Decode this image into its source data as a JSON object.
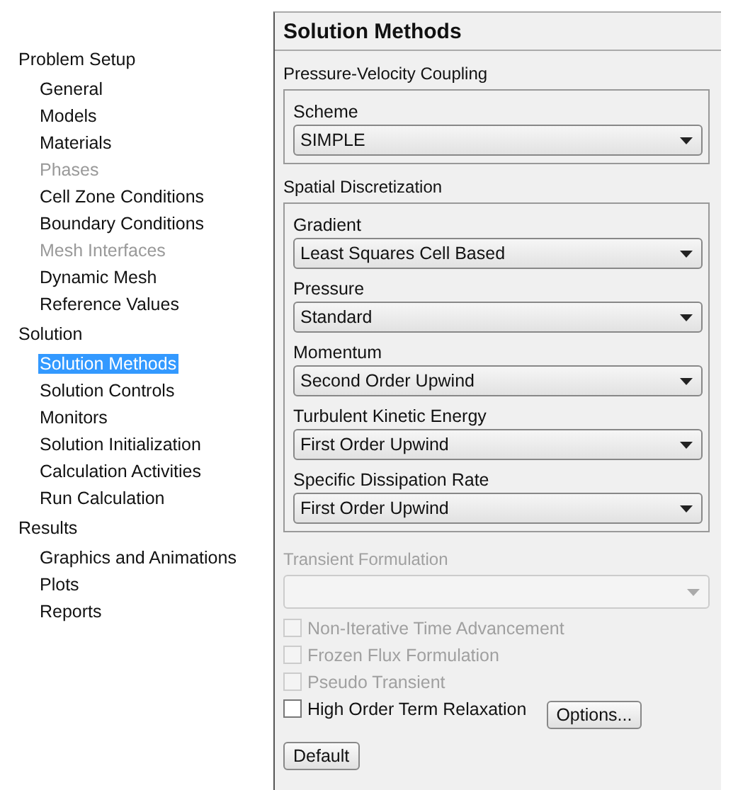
{
  "tree": [
    {
      "label": "Problem Setup",
      "items": [
        {
          "label": "General",
          "selected": false,
          "disabled": false
        },
        {
          "label": "Models",
          "selected": false,
          "disabled": false
        },
        {
          "label": "Materials",
          "selected": false,
          "disabled": false
        },
        {
          "label": "Phases",
          "selected": false,
          "disabled": true
        },
        {
          "label": "Cell Zone Conditions",
          "selected": false,
          "disabled": false
        },
        {
          "label": "Boundary Conditions",
          "selected": false,
          "disabled": false
        },
        {
          "label": "Mesh Interfaces",
          "selected": false,
          "disabled": true
        },
        {
          "label": "Dynamic Mesh",
          "selected": false,
          "disabled": false
        },
        {
          "label": "Reference Values",
          "selected": false,
          "disabled": false
        }
      ]
    },
    {
      "label": "Solution",
      "items": [
        {
          "label": "Solution Methods",
          "selected": true,
          "disabled": false
        },
        {
          "label": "Solution Controls",
          "selected": false,
          "disabled": false
        },
        {
          "label": "Monitors",
          "selected": false,
          "disabled": false
        },
        {
          "label": "Solution Initialization",
          "selected": false,
          "disabled": false
        },
        {
          "label": "Calculation Activities",
          "selected": false,
          "disabled": false
        },
        {
          "label": "Run Calculation",
          "selected": false,
          "disabled": false
        }
      ]
    },
    {
      "label": "Results",
      "items": [
        {
          "label": "Graphics and Animations",
          "selected": false,
          "disabled": false
        },
        {
          "label": "Plots",
          "selected": false,
          "disabled": false
        },
        {
          "label": "Reports",
          "selected": false,
          "disabled": false
        }
      ]
    }
  ],
  "panel": {
    "title": "Solution Methods",
    "groups": [
      {
        "label": "Pressure-Velocity Coupling",
        "fields": [
          {
            "label": "Scheme",
            "value": "SIMPLE"
          }
        ]
      },
      {
        "label": "Spatial Discretization",
        "fields": [
          {
            "label": "Gradient",
            "value": "Least Squares Cell Based"
          },
          {
            "label": "Pressure",
            "value": "Standard"
          },
          {
            "label": "Momentum",
            "value": "Second Order Upwind"
          },
          {
            "label": "Turbulent Kinetic Energy",
            "value": "First Order Upwind"
          },
          {
            "label": "Specific Dissipation Rate",
            "value": "First Order Upwind"
          }
        ]
      }
    ],
    "transient": {
      "label": "Transient Formulation",
      "disabled": true
    },
    "checkboxes": [
      {
        "label": "Non-Iterative Time Advancement",
        "checked": false,
        "disabled": true
      },
      {
        "label": "Frozen Flux Formulation",
        "checked": false,
        "disabled": true
      },
      {
        "label": "Pseudo Transient",
        "checked": false,
        "disabled": true
      },
      {
        "label": "High Order Term Relaxation",
        "checked": false,
        "disabled": false,
        "button": "Options..."
      }
    ],
    "default_button": "Default"
  }
}
